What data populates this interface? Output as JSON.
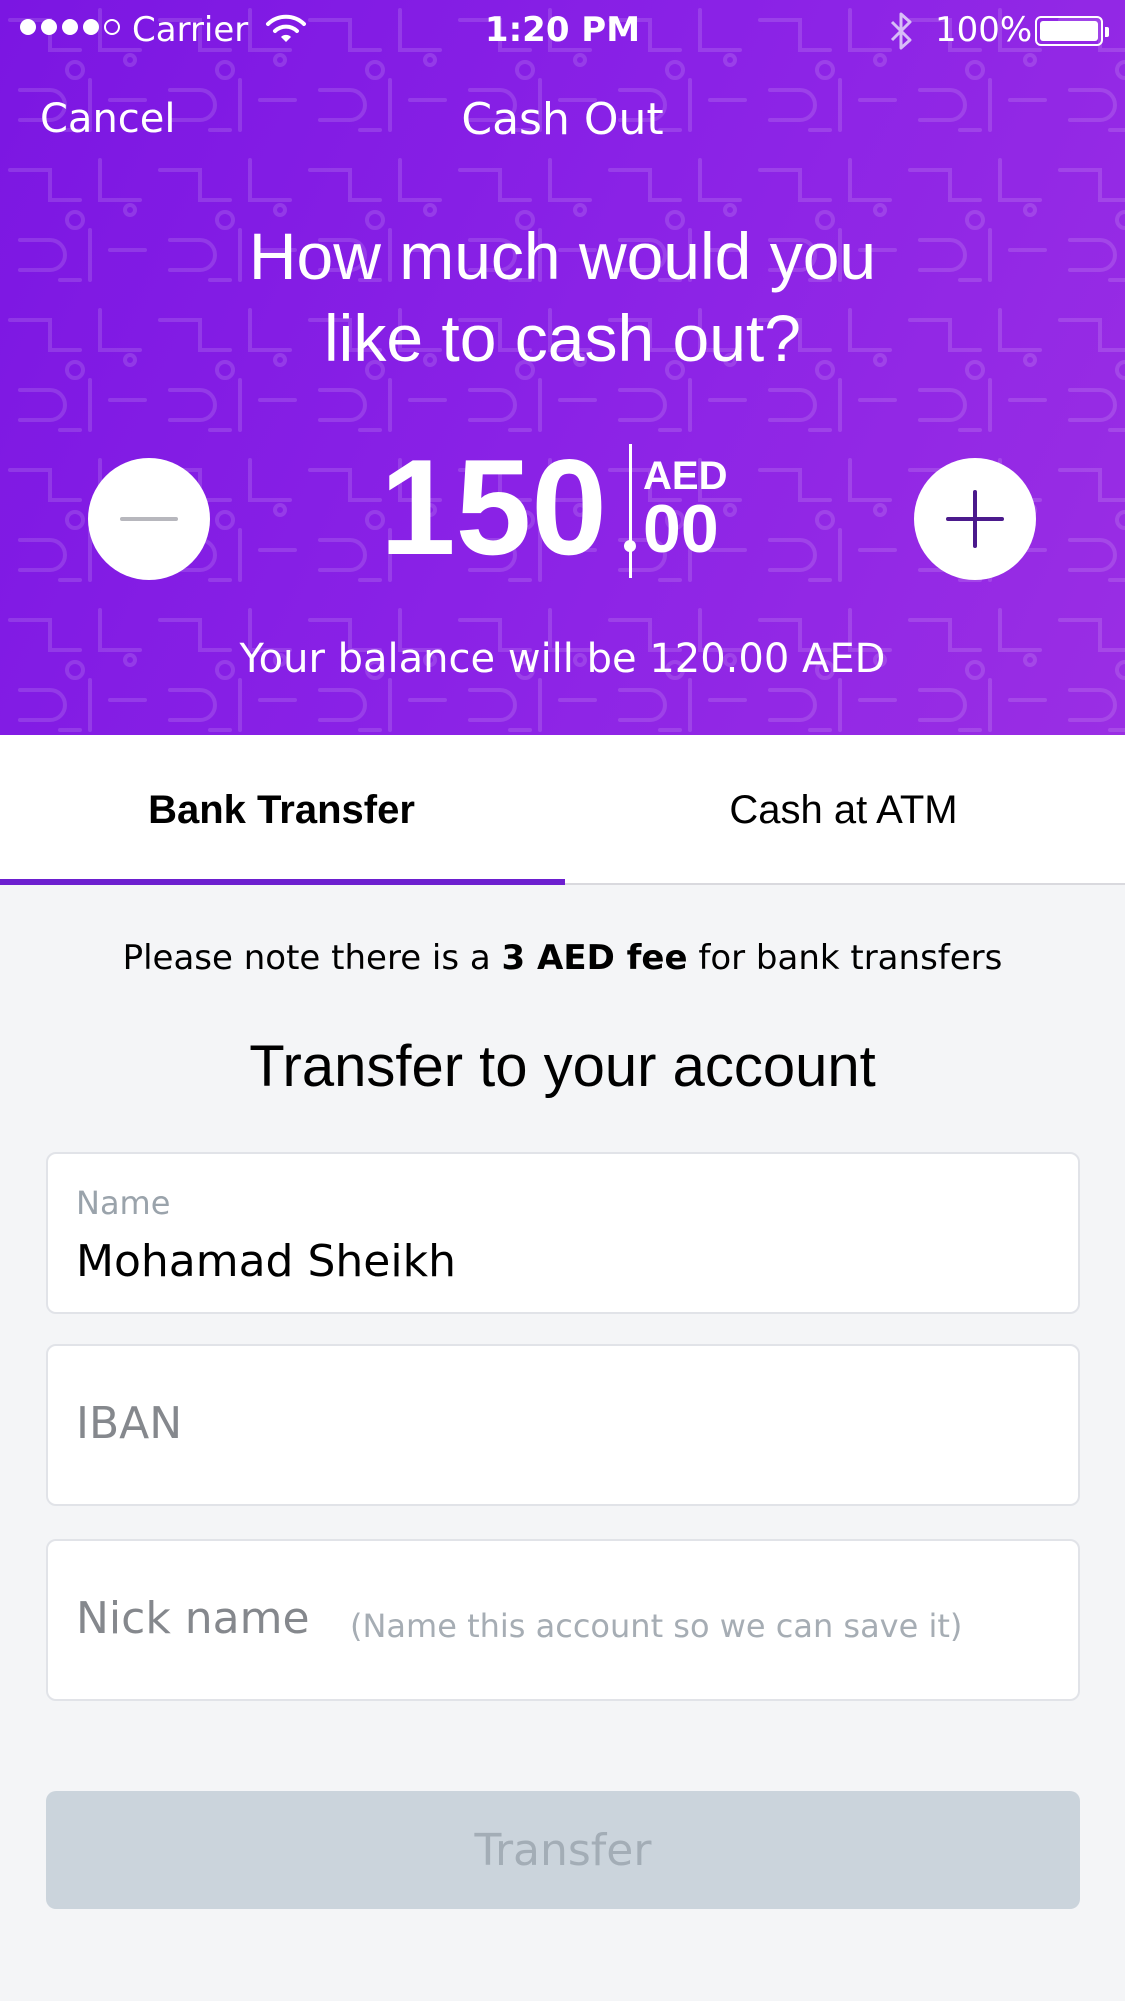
{
  "status_bar": {
    "carrier": "Carrier",
    "time": "1:20 PM",
    "battery": "100%"
  },
  "nav": {
    "cancel": "Cancel",
    "title": "Cash Out"
  },
  "header": {
    "question_line1": "How much would you",
    "question_line2": "like to cash out?",
    "amount_integer": "150",
    "currency": "AED",
    "amount_decimal": "00",
    "balance_text": "Your balance will be 120.00 AED"
  },
  "tabs": [
    {
      "label": "Bank Transfer",
      "active": true
    },
    {
      "label": "Cash at ATM",
      "active": false
    }
  ],
  "notice": {
    "prefix": "Please note there is a ",
    "bold": "3 AED fee",
    "suffix": " for bank transfers"
  },
  "section_title": "Transfer to your account",
  "form": {
    "name_label": "Name",
    "name_value": "Mohamad Sheikh",
    "iban_placeholder": "IBAN",
    "nick_placeholder": "Nick name",
    "nick_hint": "(Name this account so we can save it)"
  },
  "submit_label": "Transfer",
  "colors": {
    "brand_purple": "#7b16e2",
    "tab_indicator": "#6d1fcf",
    "button_disabled": "#cbd4dc"
  },
  "icons": [
    "wifi-icon",
    "bluetooth-icon",
    "battery-icon",
    "minus-icon",
    "plus-icon"
  ]
}
